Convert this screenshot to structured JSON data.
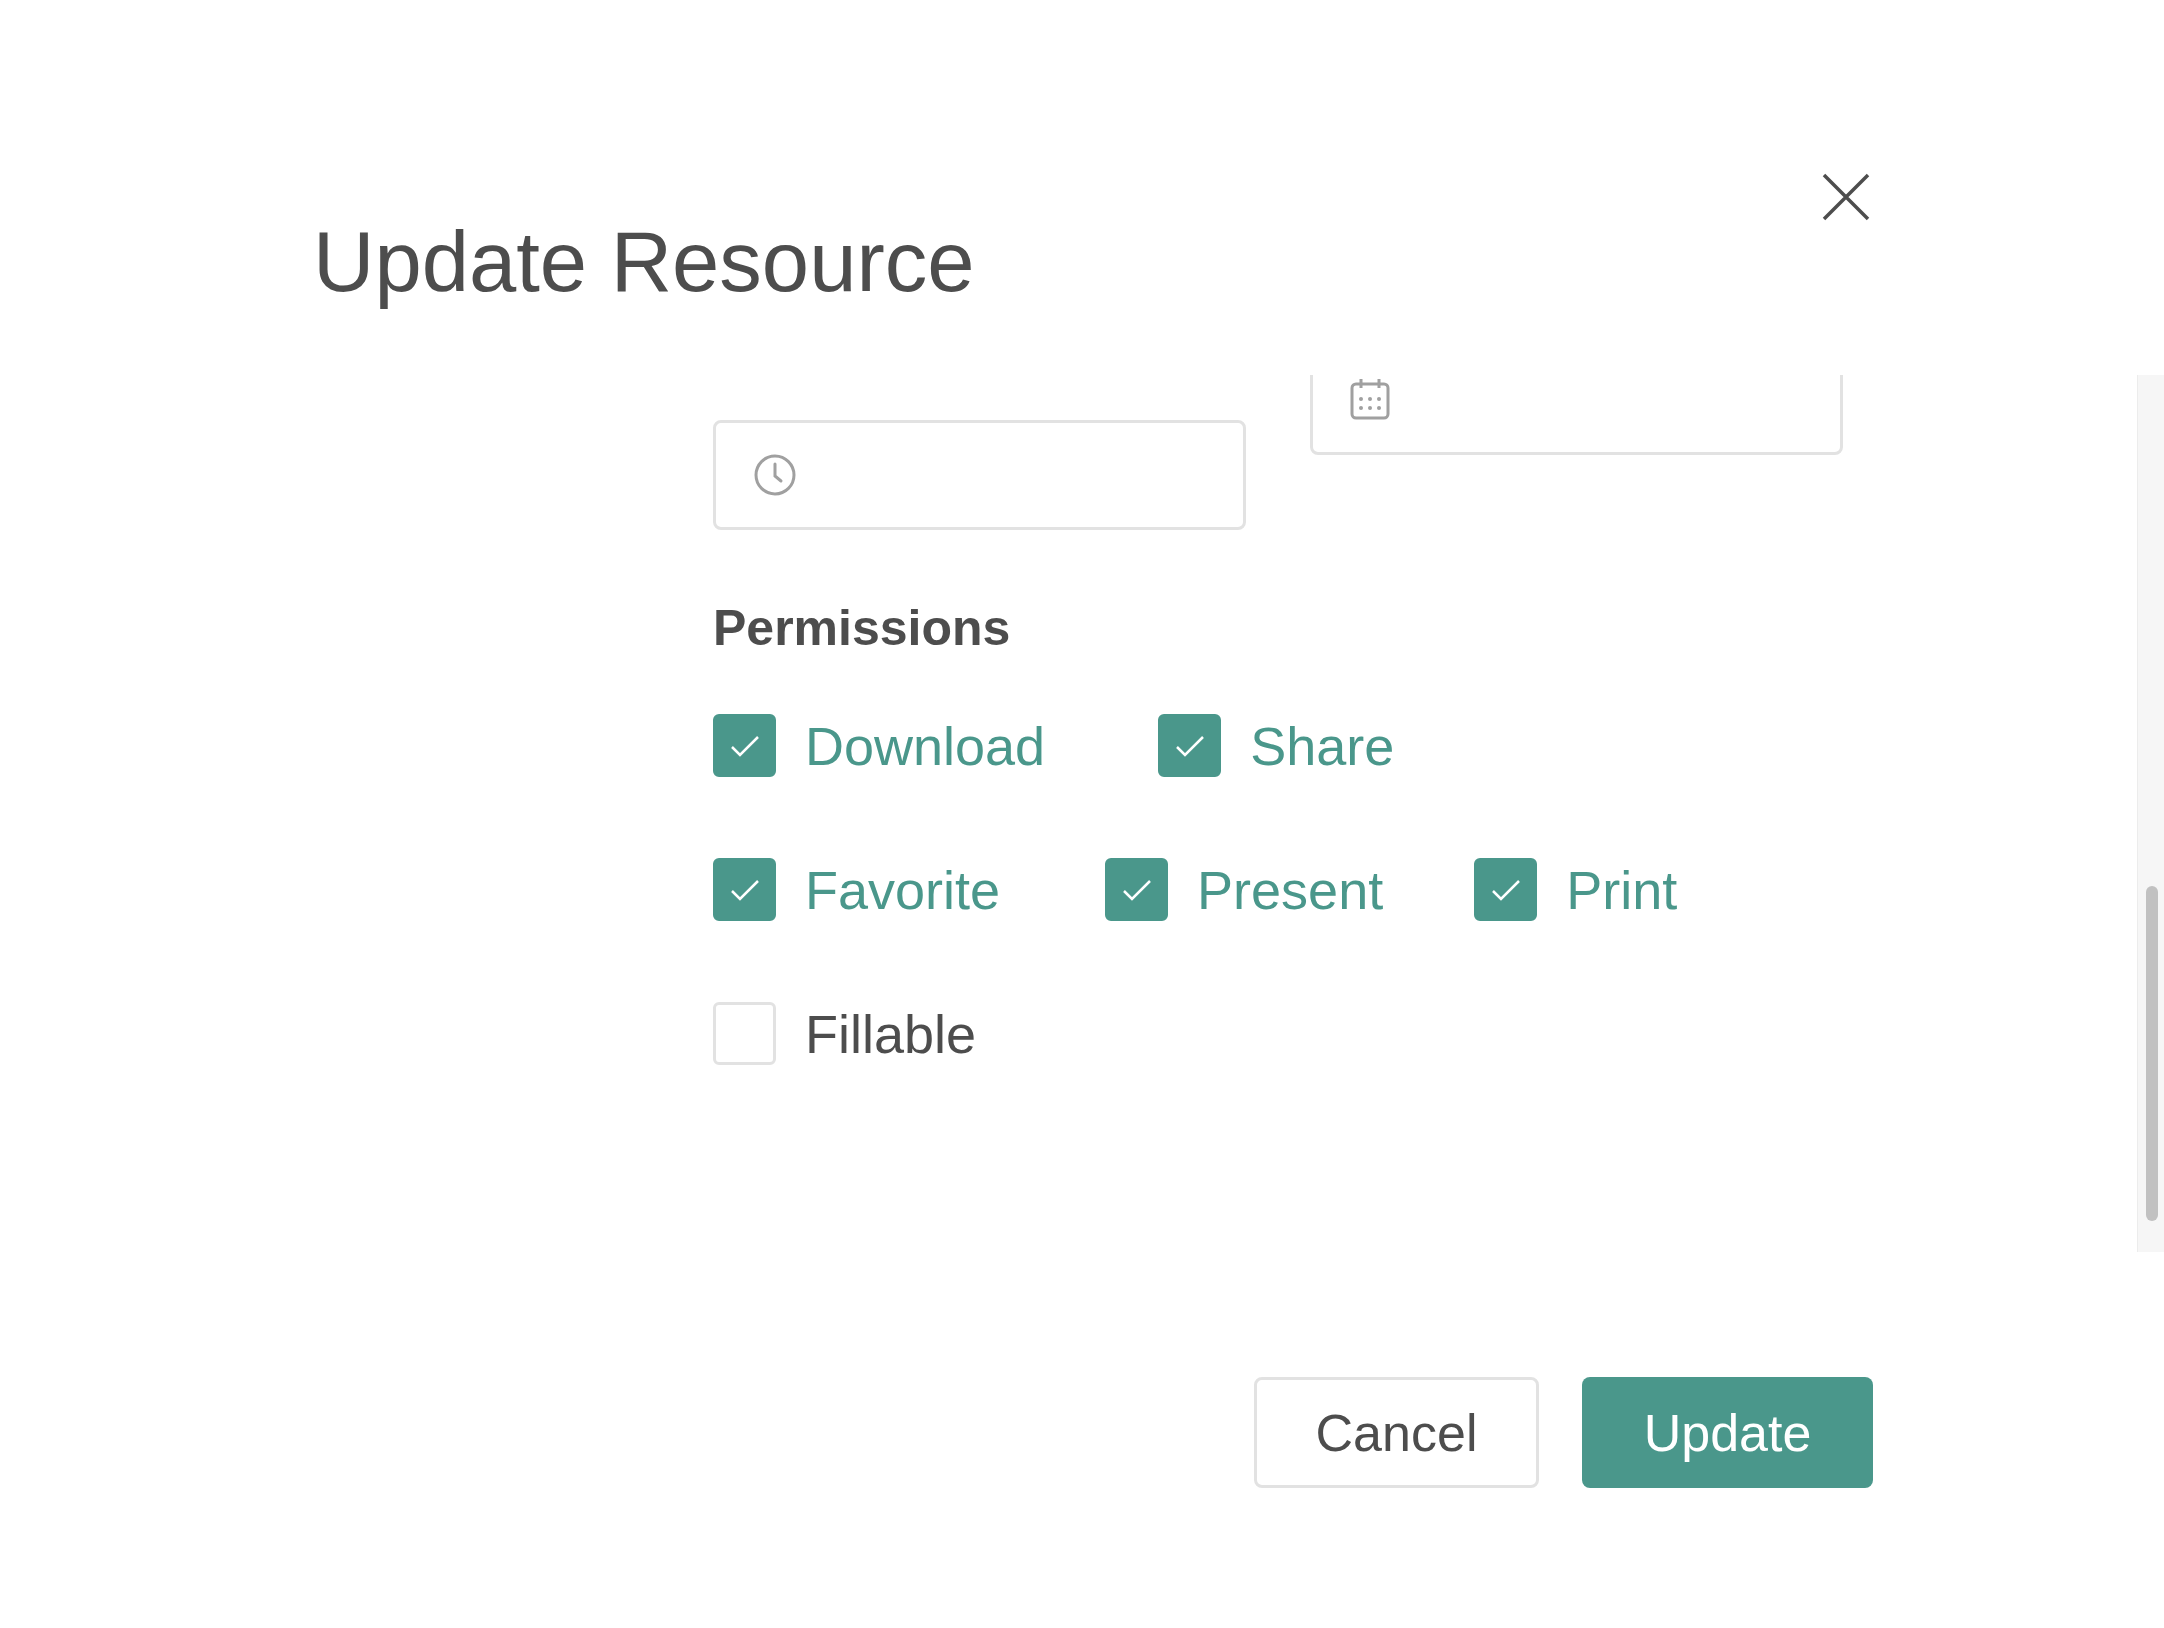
{
  "dialog": {
    "title": "Update Resource"
  },
  "fields": [
    {
      "kind": "time"
    },
    {
      "kind": "date"
    }
  ],
  "permissions": {
    "heading": "Permissions",
    "rows": [
      [
        {
          "label": "Download",
          "checked": true
        },
        {
          "label": "Share",
          "checked": true
        }
      ],
      [
        {
          "label": "Favorite",
          "checked": true
        },
        {
          "label": "Present",
          "checked": true
        },
        {
          "label": "Print",
          "checked": true
        }
      ],
      [
        {
          "label": "Fillable",
          "checked": false
        }
      ]
    ]
  },
  "buttons": [
    {
      "label": "Cancel",
      "kind": "secondary"
    },
    {
      "label": "Update",
      "kind": "primary"
    }
  ]
}
